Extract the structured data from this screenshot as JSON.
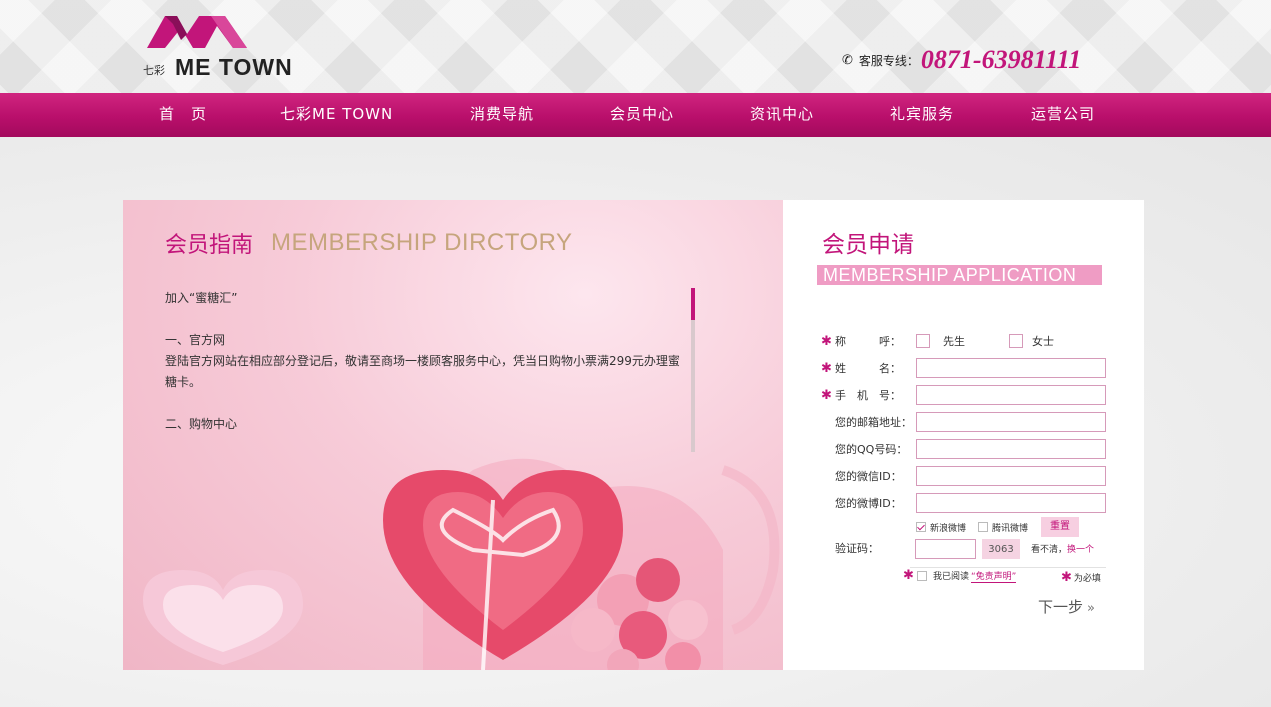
{
  "header": {
    "logo_small": "七彩",
    "logo_text": "ME TOWN",
    "hotline_label": "客服专线：",
    "hotline_number": "0871-63981111"
  },
  "nav": {
    "items": [
      "首　页",
      "七彩ME TOWN",
      "消费导航",
      "会员中心",
      "资讯中心",
      "礼宾服务",
      "运营公司"
    ]
  },
  "guide": {
    "title": "会员指南",
    "title_en": "MEMBERSHIP DIRCTORY",
    "paragraphs": [
      "加入“蜜糖汇”",
      "一、官方网",
      "登陆官方网站在相应部分登记后，敬请至商场一楼顾客服务中心，凭当日购物小票满299元办理蜜糖卡。",
      "二、购物中心"
    ]
  },
  "apply": {
    "title": "会员申请",
    "title_en": "MEMBERSHIP APPLICATION",
    "salutation_label": "称　　　呼：",
    "salutation_options": [
      "先生",
      "女士"
    ],
    "name_label": "姓　　　名：",
    "phone_label": "手　机　号：",
    "email_label": "您的邮箱地址：",
    "qq_label": "您的QQ号码：",
    "wechat_label": "您的微信ID：",
    "weibo_label": "您的微博ID：",
    "weibo_options": [
      "新浪微博",
      "腾讯微博"
    ],
    "reset_label": "重置",
    "captcha_label": "验证码：",
    "captcha_code": "3063",
    "captcha_hint": "看不清，",
    "captcha_change": "换一个",
    "agree_text": "我已阅读",
    "agree_link": "“免责声明”",
    "required_note": "为必填",
    "next_label": "下一步"
  },
  "colors": {
    "brand": "#c2157a",
    "nav_bg": "#b90f6b",
    "accent_label_bg": "#ef9cc4"
  }
}
